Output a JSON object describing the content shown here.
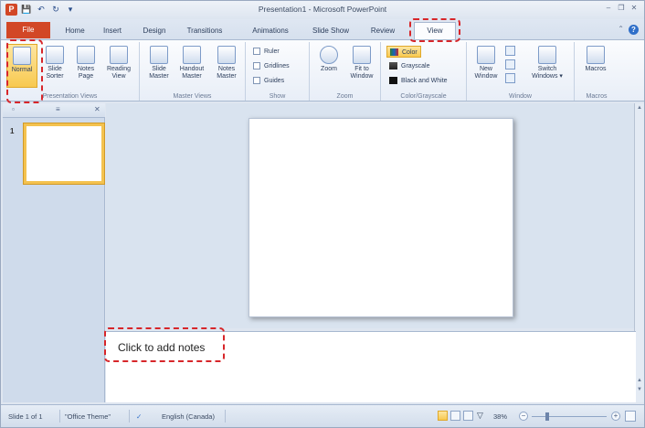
{
  "window": {
    "title": "Presentation1 - Microsoft PowerPoint",
    "app_icon_letter": "P",
    "qat_icons": [
      "save-icon",
      "undo-icon",
      "redo-icon",
      "customize-qat-icon"
    ],
    "controls": [
      "minimize-icon",
      "restore-icon",
      "close-icon"
    ]
  },
  "tabs": {
    "file": "File",
    "items": [
      "Home",
      "Insert",
      "Design",
      "Transitions",
      "Animations",
      "Slide Show",
      "Review"
    ],
    "active": "View"
  },
  "ribbon": {
    "presentation_views": {
      "label": "Presentation Views",
      "normal": "Normal",
      "slide_sorter": [
        "Slide",
        "Sorter"
      ],
      "notes_page": [
        "Notes",
        "Page"
      ],
      "reading_view": [
        "Reading",
        "View"
      ]
    },
    "master_views": {
      "label": "Master Views",
      "slide_master": [
        "Slide",
        "Master"
      ],
      "handout_master": [
        "Handout",
        "Master"
      ],
      "notes_master": [
        "Notes",
        "Master"
      ]
    },
    "show": {
      "label": "Show",
      "ruler": "Ruler",
      "gridlines": "Gridlines",
      "guides": "Guides"
    },
    "zoom": {
      "label": "Zoom",
      "zoom": "Zoom",
      "fit_to_window": [
        "Fit to",
        "Window"
      ]
    },
    "color_grayscale": {
      "label": "Color/Grayscale",
      "color": "Color",
      "grayscale": "Grayscale",
      "black_white": "Black and White"
    },
    "window": {
      "label": "Window",
      "new_window": [
        "New",
        "Window"
      ],
      "switch_windows": [
        "Switch",
        "Windows"
      ]
    },
    "macros": {
      "label": "Macros",
      "macros": "Macros"
    }
  },
  "left_pane": {
    "slide_number": "1"
  },
  "notes": {
    "placeholder": "Click to add notes"
  },
  "status": {
    "slide": "Slide 1 of 1",
    "theme": "\"Office Theme\"",
    "language": "English (Canada)",
    "zoom": "38%"
  },
  "colors": {
    "accent_file_tab": "#d24726",
    "highlight": "#f8c94f",
    "callout_red": "#d7262a"
  }
}
